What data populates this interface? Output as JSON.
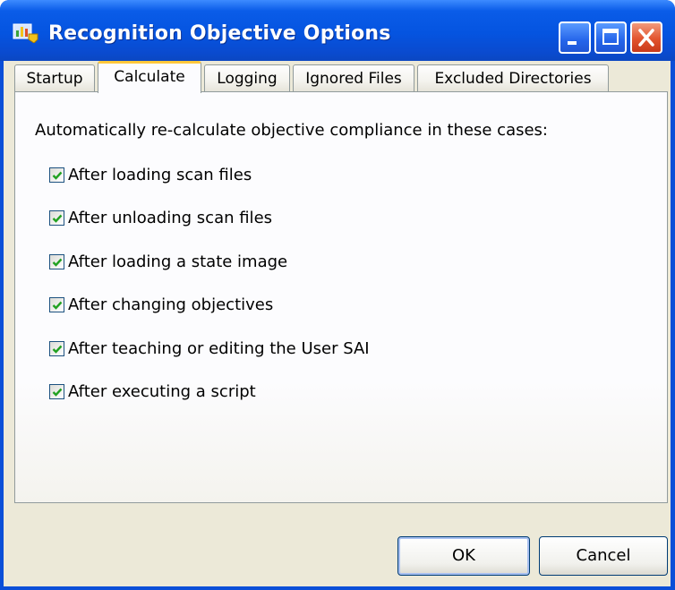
{
  "window": {
    "title": "Recognition Objective Options",
    "icon": "app-icon",
    "controls": [
      "minimize-icon",
      "maximize-icon",
      "close-icon"
    ]
  },
  "tabs": [
    {
      "label": "Startup",
      "active": false
    },
    {
      "label": "Calculate",
      "active": true
    },
    {
      "label": "Logging",
      "active": false
    },
    {
      "label": "Ignored Files",
      "active": false
    },
    {
      "label": "Excluded Directories",
      "active": false
    }
  ],
  "calculate": {
    "intro": "Automatically re-calculate objective compliance in these cases:",
    "options": [
      {
        "label": "After loading scan files",
        "checked": true
      },
      {
        "label": "After unloading scan files",
        "checked": true
      },
      {
        "label": "After loading a state image",
        "checked": true
      },
      {
        "label": "After changing objectives",
        "checked": true
      },
      {
        "label": "After teaching or editing the User SAI",
        "checked": true
      },
      {
        "label": "After executing a script",
        "checked": true
      }
    ]
  },
  "buttons": {
    "ok": "OK",
    "cancel": "Cancel"
  },
  "colors": {
    "title_bar": "#0554e0",
    "dialog_face": "#ece9d8",
    "check_mark": "#21a121",
    "active_tab_accent": "#ffc83c",
    "close_button": "#e2542e"
  }
}
